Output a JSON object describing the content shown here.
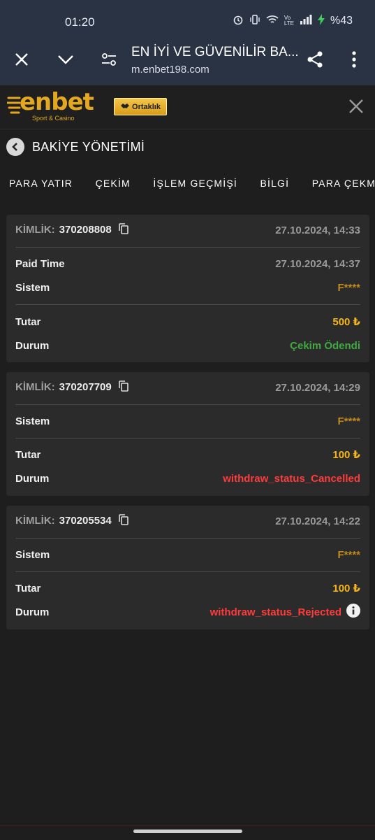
{
  "status_bar": {
    "time": "01:20",
    "battery": "%43"
  },
  "browser": {
    "title": "EN İYİ VE GÜVENİLİR BA...",
    "url": "m.enbet198.com"
  },
  "site": {
    "logo": "enbet",
    "logo_sub": "Sport & Casino",
    "partner_label": "Ortaklık"
  },
  "page": {
    "title": "BAKİYE YÖNETİMİ"
  },
  "tabs": [
    "PARA YATIR",
    "ÇEKİM",
    "İŞLEM GEÇMİŞİ",
    "BİLGİ",
    "PARA ÇEKME DURUMU"
  ],
  "labels": {
    "id": "KİMLİK:",
    "paid_time": "Paid Time",
    "system": "Sistem",
    "amount": "Tutar",
    "status": "Durum"
  },
  "transactions": [
    {
      "id": "370208808",
      "date": "27.10.2024, 14:33",
      "paid_time": "27.10.2024, 14:37",
      "system": "F****",
      "amount": "500 ₺",
      "status": "Çekim Ödendi"
    },
    {
      "id": "370207709",
      "date": "27.10.2024, 14:29",
      "system": "F****",
      "amount": "100 ₺",
      "status": "withdraw_status_Cancelled"
    },
    {
      "id": "370205534",
      "date": "27.10.2024, 14:22",
      "system": "F****",
      "amount": "100 ₺",
      "status": "withdraw_status_Rejected"
    }
  ],
  "colors": {
    "accent": "#f5b51c",
    "system": "#c18a1e",
    "paid": "#3faa3f",
    "error": "#ff3b3b",
    "card": "#2b2b2b",
    "bg": "#1e1e1e"
  }
}
